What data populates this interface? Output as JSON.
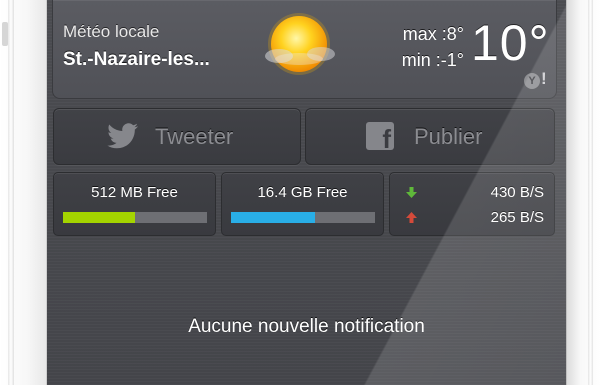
{
  "weather": {
    "location_label": "Météo locale",
    "city": "St.-Nazaire-les...",
    "max": "max :8°",
    "min": "min :-1°",
    "current_temp": "10°",
    "condition_icon": "sun-with-clouds-icon",
    "provider_badge": "Y",
    "provider_mark": "!"
  },
  "share": {
    "tweet_label": "Tweeter",
    "tweet_icon": "twitter-bird-icon",
    "publish_label": "Publier",
    "publish_icon": "facebook-icon"
  },
  "stats": {
    "memory": {
      "label": "512 MB Free",
      "fill_fraction": 0.5,
      "color": "#a4d400"
    },
    "disk": {
      "label": "16.4 GB Free",
      "fill_fraction": 0.58,
      "color": "#29aee6"
    },
    "network": {
      "download": {
        "value": "430 B/S",
        "icon": "download-arrow-icon",
        "color": "#5fb83a"
      },
      "upload": {
        "value": "265 B/S",
        "icon": "upload-arrow-icon",
        "color": "#d44a3a"
      }
    }
  },
  "notifications": {
    "empty_message": "Aucune nouvelle notification"
  }
}
